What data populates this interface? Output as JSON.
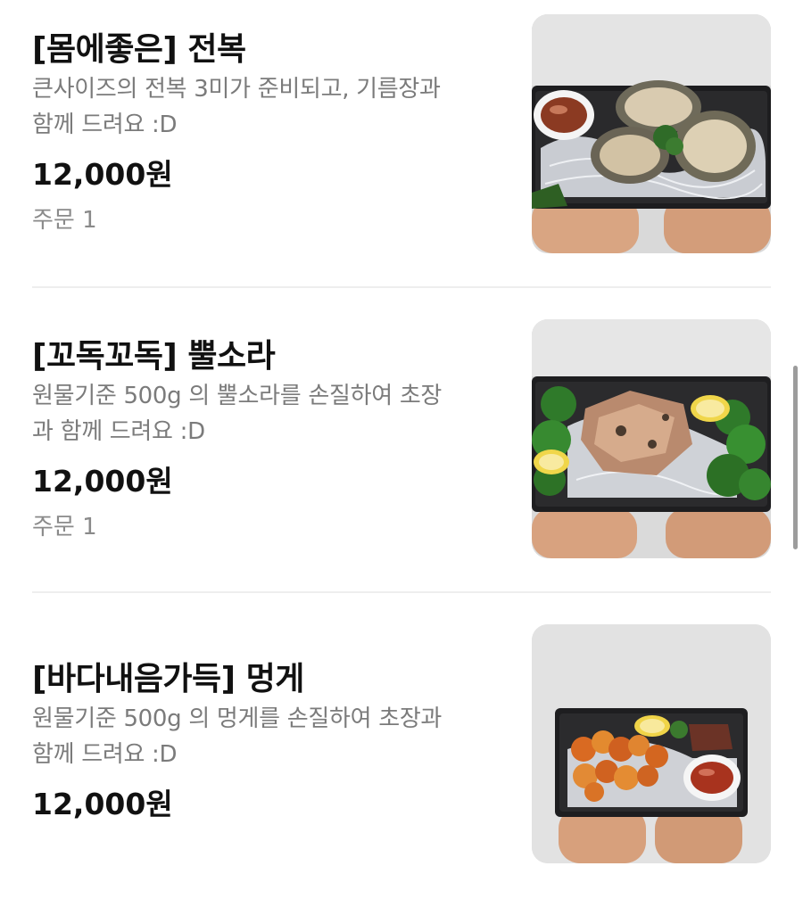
{
  "menu": {
    "items": [
      {
        "title": "[몸에좋은] 전복",
        "description_line1": "큰사이즈의 전복 3미가 준비되고, 기름장과",
        "description_line2": "함께 드려요 :D",
        "price": "12,000원",
        "orders": "주문 1",
        "photo_icon": "abalone-dish-photo"
      },
      {
        "title": "[꼬독꼬독] 뿔소라",
        "description_line1": "원물기준 500g 의 뿔소라를 손질하여 초장",
        "description_line2": "과 함께 드려요 :D",
        "price": "12,000원",
        "orders": "주문 1",
        "photo_icon": "turban-shell-dish-photo"
      },
      {
        "title": "[바다내음가득] 멍게",
        "description_line1": "원물기준 500g 의 멍게를 손질하여 초장과",
        "description_line2": "함께 드려요 :D",
        "price": "12,000원",
        "photo_icon": "sea-squirt-dish-photo"
      }
    ]
  },
  "colors": {
    "title": "#111111",
    "description": "#7b7b7b",
    "divider": "#eeeeee",
    "scrollbar": "#9c9c9c"
  }
}
